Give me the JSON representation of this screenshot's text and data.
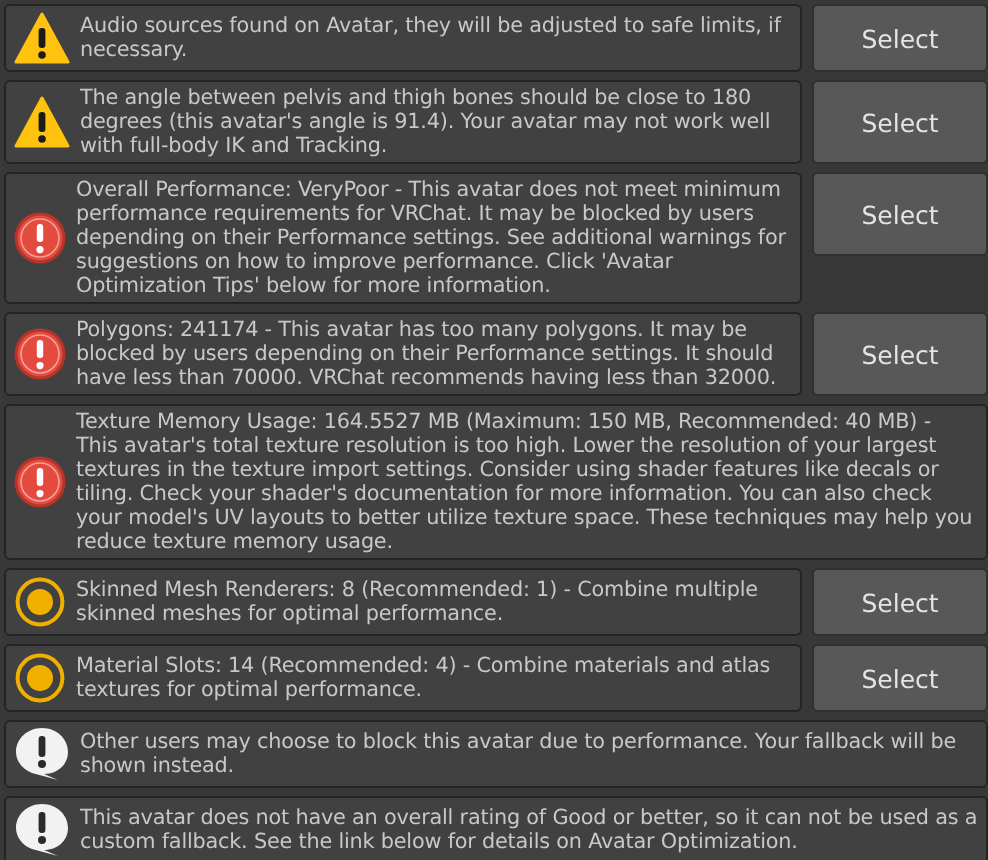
{
  "messages": [
    {
      "kind": "warning",
      "text": "Audio sources found on Avatar, they will be adjusted to safe limits, if necessary.",
      "button": "Select"
    },
    {
      "kind": "warning",
      "text": "The angle between pelvis and thigh bones should be close to 180 degrees (this avatar's angle is 91.4). Your avatar may not work well with full-body IK and Tracking.",
      "button": "Select"
    },
    {
      "kind": "error",
      "text": "Overall Performance: VeryPoor - This avatar does not meet minimum performance requirements for VRChat. It may be blocked by users depending on their Performance settings. See additional warnings for suggestions on how to improve performance. Click 'Avatar Optimization Tips' below for more information.",
      "button": "Select"
    },
    {
      "kind": "error",
      "text": "Polygons: 241174 - This avatar has too many polygons. It may be blocked by users depending on their Performance settings. It should have less than 70000. VRChat recommends having less than 32000.",
      "button": "Select"
    },
    {
      "kind": "error",
      "text": "Texture Memory Usage: 164.5527 MB (Maximum: 150 MB, Recommended: 40 MB) - This avatar's total texture resolution is too high. Lower the resolution of your largest textures in the texture import settings. Consider using shader features like decals or tiling. Check your shader's documentation for more information. You can also check your model's UV layouts to better utilize texture space. These techniques may help you reduce texture memory usage."
    },
    {
      "kind": "performance",
      "text": "Skinned Mesh Renderers: 8 (Recommended: 1) - Combine multiple skinned meshes for optimal performance.",
      "button": "Select"
    },
    {
      "kind": "performance",
      "text": "Material Slots: 14 (Recommended: 4) - Combine materials and atlas textures for optimal performance.",
      "button": "Select"
    },
    {
      "kind": "info",
      "text": "Other users may choose to block this avatar due to performance. Your fallback will be shown instead."
    },
    {
      "kind": "info",
      "text": "This avatar does not have an overall rating of Good or better, so it can not be used as a custom fallback. See the link below for details on Avatar Optimization."
    }
  ]
}
